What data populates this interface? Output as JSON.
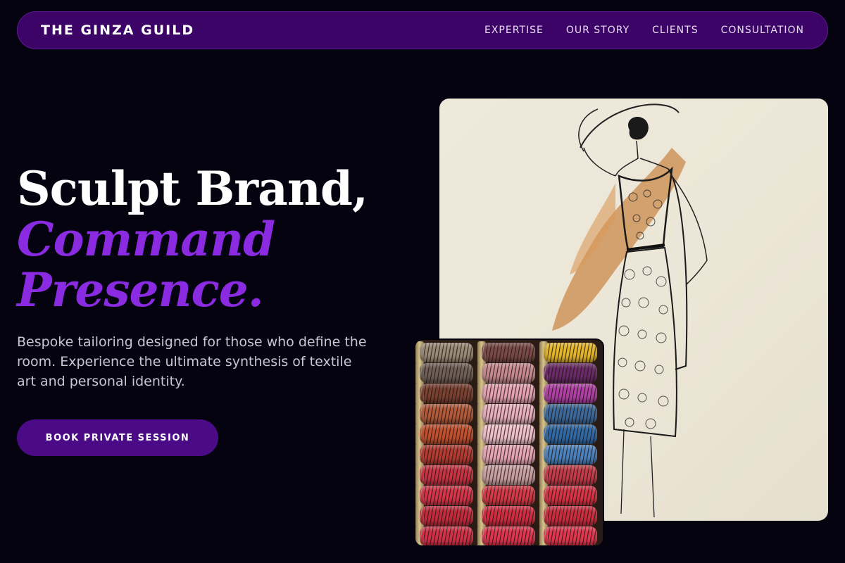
{
  "nav": {
    "brand": "THE GINZA GUILD",
    "links": [
      "EXPERTISE",
      "OUR STORY",
      "CLIENTS",
      "CONSULTATION"
    ]
  },
  "hero": {
    "title_line1": "Sculpt Brand,",
    "title_line2": "Command",
    "title_line3": "Presence.",
    "description": "Bespoke tailoring designed for those who define the room. Experience the ultimate synthesis of textile art and personal identity.",
    "cta_label": "BOOK PRIVATE SESSION"
  },
  "colors": {
    "background": "#05030f",
    "nav_bg": "#3d0468",
    "accent": "#8a2be2",
    "cta_bg": "#4b0a86"
  },
  "images": {
    "sketch": "fashion-sketch-dress",
    "threads": "thread-spools-rack"
  },
  "thread_colors": [
    [
      "#9a8a78",
      "#6e6058",
      "#7a4032",
      "#b35a3a",
      "#c2502e",
      "#b43a32",
      "#c83244",
      "#d6344a",
      "#c42a3e",
      "#d23048"
    ],
    [
      "#7a4a48",
      "#c88a92",
      "#e4a2b2",
      "#e8b0c0",
      "#eec0cc",
      "#e7a6b6",
      "#c8a0a4",
      "#d63848",
      "#d22c44",
      "#e03450"
    ],
    [
      "#e4b62a",
      "#6a2a6a",
      "#b040a8",
      "#3a6a9e",
      "#2f6aa8",
      "#4a82c0",
      "#c43a4a",
      "#d83246",
      "#cc2c40",
      "#e23650"
    ]
  ]
}
